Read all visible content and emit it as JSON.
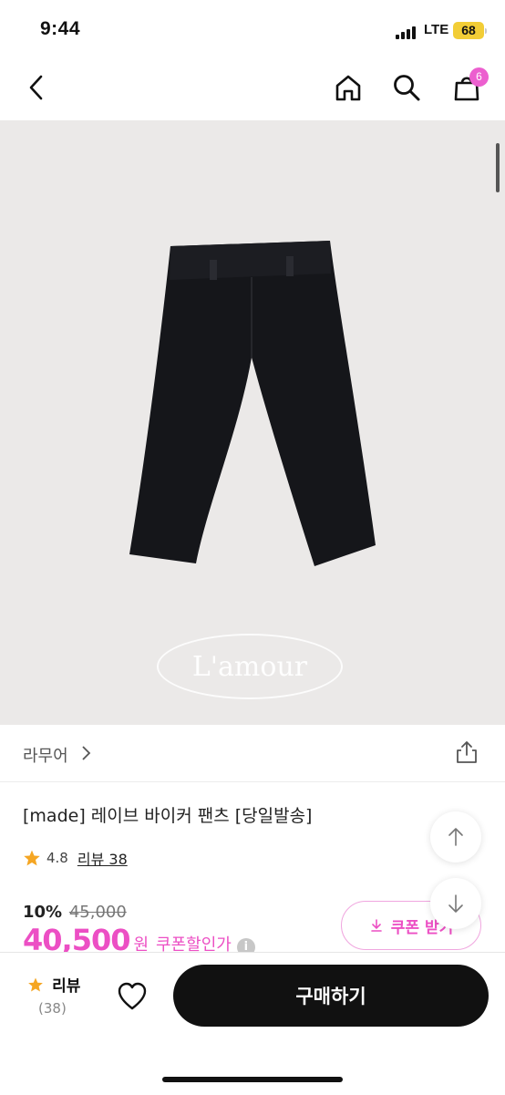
{
  "status": {
    "time": "9:44",
    "network": "LTE",
    "battery": "68"
  },
  "nav": {
    "cart_count": "6"
  },
  "image": {
    "watermark": "L'amour"
  },
  "seller": {
    "name": "라무어"
  },
  "product": {
    "title": "[made] 레이브 바이커 팬츠 [당일발송]",
    "rating": "4.8",
    "review_link": "리뷰 38",
    "discount_rate": "10%",
    "original_price": "45,000",
    "sale_price": "40,500",
    "currency": "원",
    "coupon_text": "쿠폰할인가",
    "coupon_button": "쿠폰 받기"
  },
  "bottom": {
    "review_label": "리뷰",
    "review_count": "(38)",
    "buy_label": "구매하기"
  },
  "colors": {
    "accent": "#ec4fc4",
    "badge": "#ec5fcf",
    "star": "#f5a623",
    "battery": "#f2cd36"
  }
}
